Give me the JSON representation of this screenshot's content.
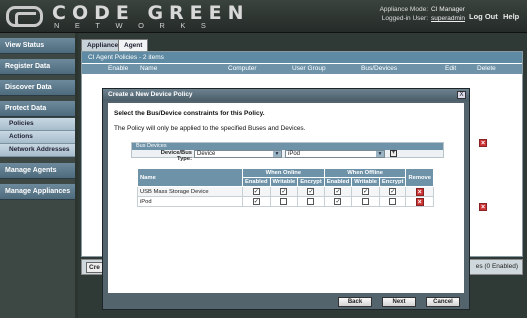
{
  "header": {
    "logo_top": "CODE GREEN",
    "logo_bottom": "NETWORKS",
    "appliance_mode_label": "Appliance Mode:",
    "appliance_mode_value": "CI Manager",
    "logged_in_label": "Logged-in User:",
    "logged_in_value": "superadmin",
    "logout": "Log Out",
    "help": "Help"
  },
  "sidebar": {
    "items": [
      {
        "label": "View Status"
      },
      {
        "label": "Register Data"
      },
      {
        "label": "Discover Data"
      },
      {
        "label": "Protect Data"
      }
    ],
    "sub_items": [
      {
        "label": "Policies"
      },
      {
        "label": "Actions"
      },
      {
        "label": "Network Addresses"
      }
    ],
    "items2": [
      {
        "label": "Manage Agents"
      },
      {
        "label": "Manage Appliances"
      }
    ]
  },
  "tabs": [
    {
      "label": "Appliance"
    },
    {
      "label": "Agent"
    }
  ],
  "panel": {
    "title": "CI Agent Policies - 2 items",
    "columns": [
      "Enable",
      "Name",
      "Computer",
      "User Group",
      "Bus/Devices",
      "Edit",
      "Delete"
    ],
    "create_button": "Cre",
    "status_right": "es (0 Enabled)"
  },
  "dialog": {
    "title": "Create a New Device Policy",
    "close": "X",
    "instruction_1": "Select the Bus/Device constraints for this Policy.",
    "instruction_2": "The Policy will only be applied to the specified Buses and Devices.",
    "fieldset_legend": "Bus Devices",
    "device_bus_type_label": "Device/Bus Type:",
    "type_value": "Device",
    "device_value": "iPod",
    "table": {
      "name_header": "Name",
      "online_header": "When Online",
      "offline_header": "When Offline",
      "remove_header": "Remove",
      "sub_headers": [
        "Enabled",
        "Writable",
        "Encrypt",
        "Enabled",
        "Writable",
        "Encrypt"
      ],
      "rows": [
        {
          "name": "USB Mass Storage Device",
          "checks": [
            true,
            true,
            true,
            true,
            true,
            true
          ]
        },
        {
          "name": "iPod",
          "checks": [
            true,
            false,
            false,
            true,
            false,
            false
          ]
        }
      ]
    },
    "back": "Back",
    "next": "Next",
    "cancel": "Cancel"
  }
}
